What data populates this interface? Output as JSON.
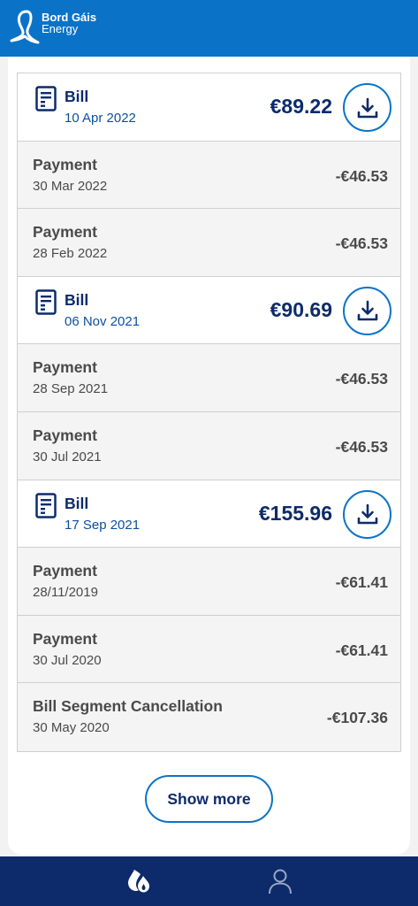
{
  "brand": {
    "line1": "Bord Gáis",
    "line2": "Energy"
  },
  "transactions": [
    {
      "type": "bill",
      "label": "Bill",
      "date": "10 Apr 2022",
      "amount": "€89.22"
    },
    {
      "type": "payment",
      "label": "Payment",
      "date": "30 Mar 2022",
      "amount": "-€46.53"
    },
    {
      "type": "payment",
      "label": "Payment",
      "date": "28 Feb 2022",
      "amount": "-€46.53"
    },
    {
      "type": "bill",
      "label": "Bill",
      "date": "06 Nov 2021",
      "amount": "€90.69"
    },
    {
      "type": "payment",
      "label": "Payment",
      "date": "28 Sep 2021",
      "amount": "-€46.53"
    },
    {
      "type": "payment",
      "label": "Payment",
      "date": "30 Jul 2021",
      "amount": "-€46.53"
    },
    {
      "type": "bill",
      "label": "Bill",
      "date": "17 Sep 2021",
      "amount": "€155.96"
    },
    {
      "type": "payment",
      "label": "Payment",
      "date": "28/11/2019",
      "amount": "-€61.41"
    },
    {
      "type": "payment",
      "label": "Payment",
      "date": "30 Jul 2020",
      "amount": "-€61.41"
    },
    {
      "type": "payment",
      "label": "Bill Segment Cancellation",
      "date": "30 May 2020",
      "amount": "-€107.36"
    }
  ],
  "show_more_label": "Show more",
  "icons": {
    "bill": "bill-document-icon",
    "download": "download-icon",
    "nav_energy": "energy-drop-icon",
    "nav_account": "account-person-icon"
  },
  "colors": {
    "header": "#0b73c7",
    "nav": "#0d2b6b",
    "accent": "#0b73c7",
    "bill_text": "#0d2b6b"
  }
}
